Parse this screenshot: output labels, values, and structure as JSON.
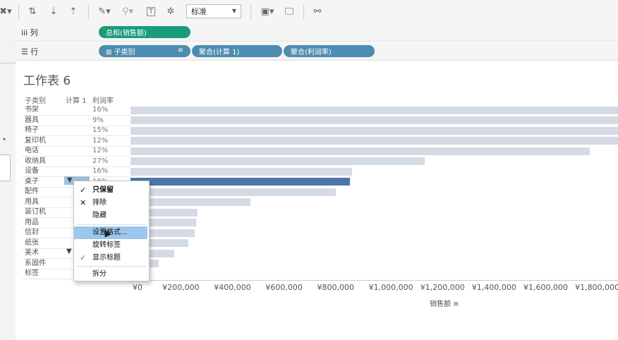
{
  "toolbar": {
    "icons": [
      "clear-sheet-icon",
      "swap-icon",
      "sort-ascending-icon",
      "sort-descending-icon",
      "highlight-pen-icon",
      "group-clip-icon",
      "label-t-icon",
      "pin-icon",
      "fit-icon",
      "presentation-icon",
      "share-icon"
    ],
    "fit_dropdown": "标准"
  },
  "shelves": {
    "columns": {
      "label": "iii 列",
      "pills": [
        "总和(销售额)"
      ]
    },
    "rows": {
      "label": "☰ 行",
      "pills": [
        "⊞ 子类别",
        "聚合(计算 1)",
        "聚合(利润率)"
      ]
    }
  },
  "sheet": {
    "title": "工作表 6",
    "headers": {
      "category": "子类别",
      "calc": "计算 1",
      "margin": "利润率"
    },
    "rows": [
      {
        "name": "书架",
        "margin": "16%"
      },
      {
        "name": "器具",
        "margin": "9%"
      },
      {
        "name": "椅子",
        "margin": "15%"
      },
      {
        "name": "复印机",
        "margin": "12%"
      },
      {
        "name": "电话",
        "margin": "12%"
      },
      {
        "name": "收纳具",
        "margin": "27%"
      },
      {
        "name": "设备",
        "margin": "16%"
      },
      {
        "name": "桌子",
        "margin": "16%"
      },
      {
        "name": "配件",
        "margin": ""
      },
      {
        "name": "用具",
        "margin": ""
      },
      {
        "name": "装订机",
        "margin": ""
      },
      {
        "name": "用品",
        "margin": ""
      },
      {
        "name": "信封",
        "margin": ""
      },
      {
        "name": "纸张",
        "margin": ""
      },
      {
        "name": "美术",
        "margin": ""
      },
      {
        "name": "系固件",
        "margin": ""
      },
      {
        "name": "标签",
        "margin": ""
      }
    ]
  },
  "chart_data": {
    "type": "bar",
    "categories": [
      "书架",
      "器具",
      "椅子",
      "复印机",
      "电话",
      "收纳具",
      "设备",
      "桌子",
      "配件",
      "用具",
      "装订机",
      "用品",
      "信封",
      "纸张",
      "美术",
      "系固件",
      "标签"
    ],
    "values": [
      1900000,
      1900000,
      1900000,
      1900000,
      1780000,
      1140000,
      860000,
      850000,
      795000,
      465000,
      260000,
      255000,
      250000,
      225000,
      170000,
      110000,
      65000
    ],
    "selected_category": "桌子",
    "xlabel": "销售额",
    "xticks": [
      "¥0",
      "¥200,000",
      "¥400,000",
      "¥600,000",
      "¥800,000",
      "¥1,000,000",
      "¥1,200,000",
      "¥1,400,000",
      "¥1,600,000",
      "¥1,800,000"
    ],
    "xlim": [
      0,
      1890000
    ],
    "colors": {
      "bar": "#d5dbe4",
      "selected": "#4b76a8"
    }
  },
  "context_menu": {
    "items": [
      {
        "label": "只保留",
        "mark": "✓"
      },
      {
        "label": "排除",
        "mark": "✕"
      },
      {
        "label": "隐藏",
        "mark": ""
      },
      {
        "label": "设置格式...",
        "mark": ""
      },
      {
        "label": "旋转标签",
        "mark": ""
      },
      {
        "label": "显示标题",
        "mark": "✓"
      },
      {
        "label": "拆分",
        "mark": ""
      }
    ]
  }
}
